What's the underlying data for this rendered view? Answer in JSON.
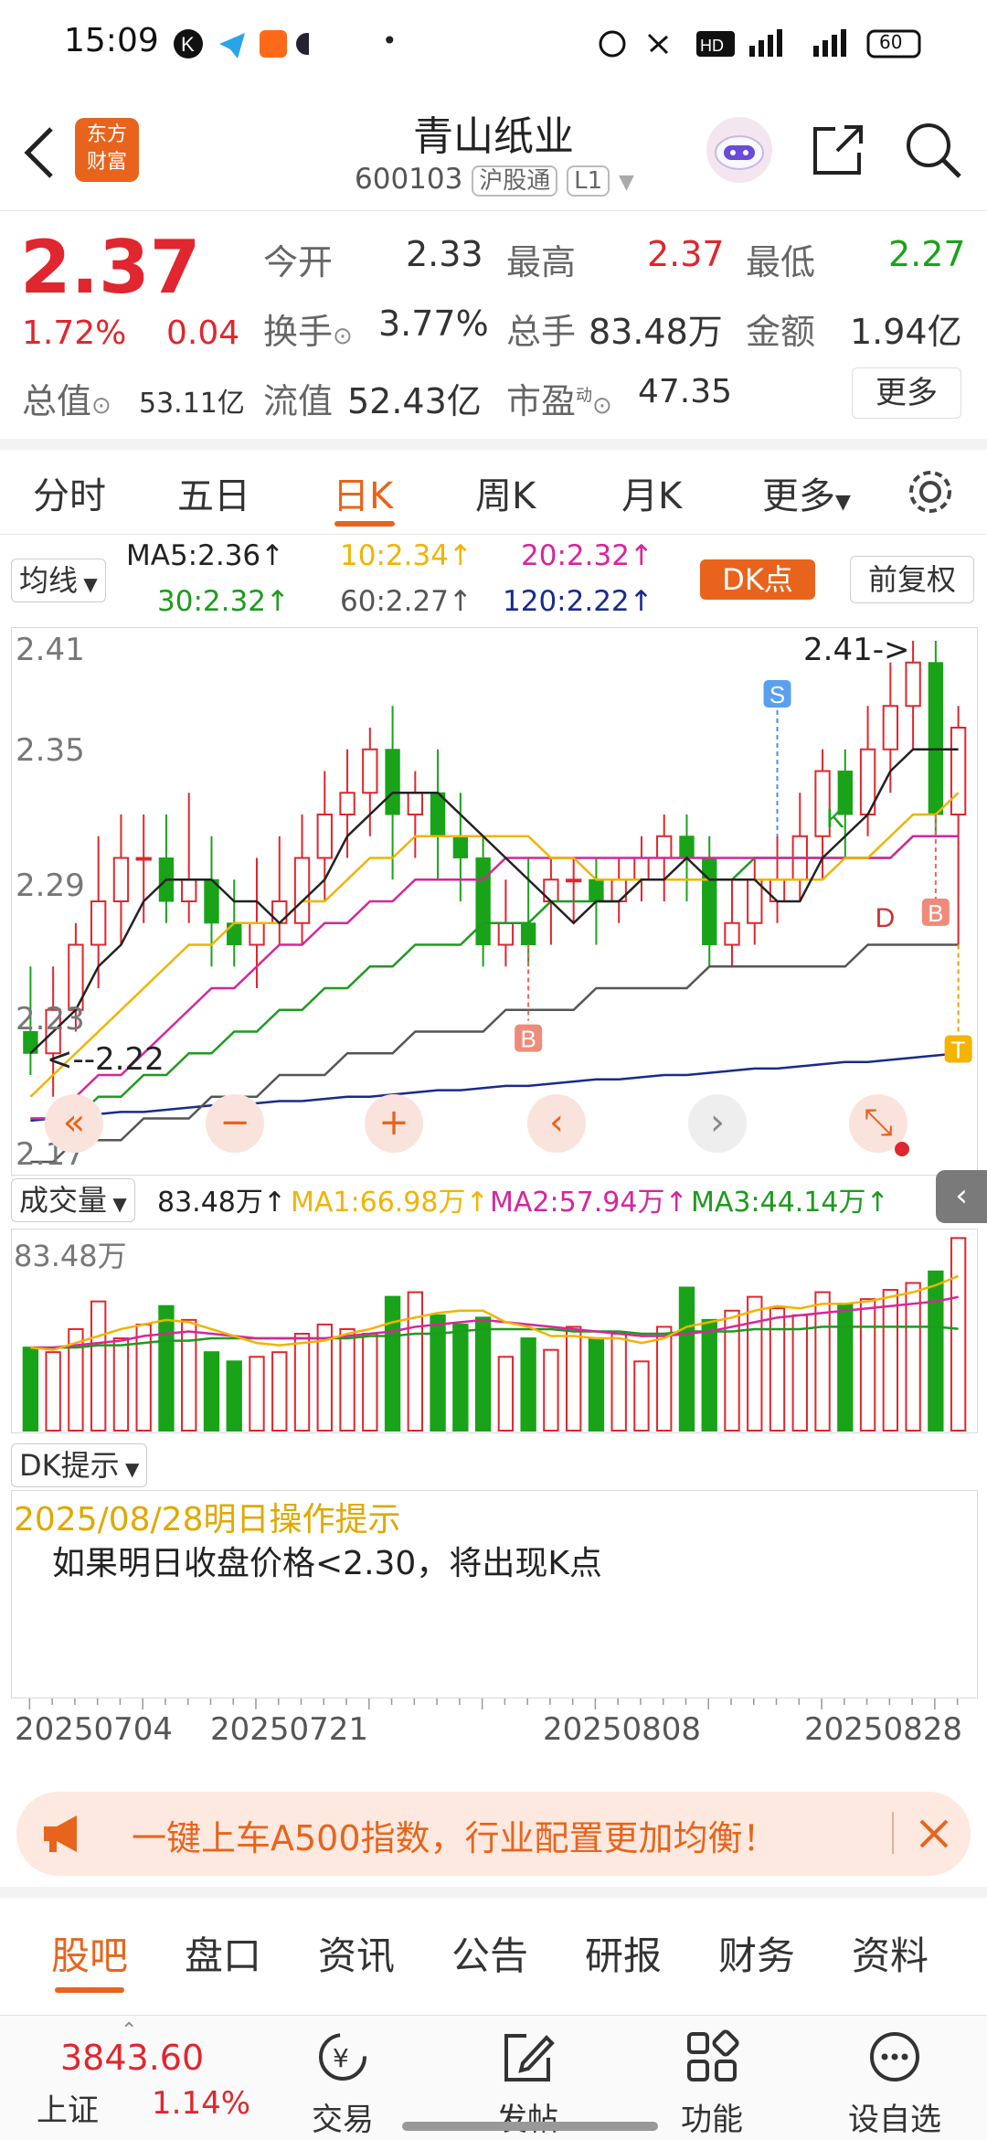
{
  "status_bar": {
    "time": "15:09",
    "battery": "60",
    "signal_a": "4G",
    "signal_b": "4G",
    "hd": "HD"
  },
  "header": {
    "title": "青山纸业",
    "code": "600103",
    "exchange_tag": "沪股通",
    "level_tag": "L1",
    "logo_line1": "东方",
    "logo_line2": "财富"
  },
  "quote": {
    "price": "2.37",
    "change_pct": "1.72%",
    "change": "0.04",
    "open_label": "今开",
    "open": "2.33",
    "high_label": "最高",
    "high": "2.37",
    "low_label": "最低",
    "low": "2.27",
    "turnover_label": "换手",
    "turnover": "3.77%",
    "volume_label": "总手",
    "volume": "83.48万",
    "amount_label": "金额",
    "amount": "1.94亿",
    "mktcap_label": "总值",
    "mktcap": "53.11亿",
    "float_label": "流值",
    "float": "52.43亿",
    "pe_label": "市盈",
    "pe_sup": "动",
    "pe": "47.35",
    "more_button": "更多"
  },
  "period_tabs": [
    "分时",
    "五日",
    "日K",
    "周K",
    "月K",
    "更多"
  ],
  "active_tab": "日K",
  "ma": {
    "selector": "均线",
    "ma5": "MA5:2.36",
    "ma10": "10:2.34",
    "ma20": "20:2.32",
    "ma30": "30:2.32",
    "ma60": "60:2.27",
    "ma120": "120:2.22",
    "dk_button": "DK点",
    "adjust_button": "前复权"
  },
  "colors": {
    "up": "#e0262e",
    "down": "#19a319",
    "ma5": "#222222",
    "ma10": "#f0b400",
    "ma20": "#d6269c",
    "ma30": "#1e9a1e",
    "ma60": "#555555",
    "ma120": "#1a2a8c",
    "accent": "#e8641c"
  },
  "chart": {
    "y_ticks": [
      "2.41",
      "2.35",
      "2.29",
      "2.23",
      "2.17"
    ],
    "max_note": "2.41->",
    "min_note": "<--2.22",
    "markers": {
      "s": "S",
      "k": "K",
      "d": "D",
      "b1": "B",
      "b2": "B",
      "t": "T"
    }
  },
  "chart_data": {
    "type": "candlestick",
    "ylim": [
      2.17,
      2.41
    ],
    "candles": [
      [
        2.23,
        2.22,
        2.26,
        2.21
      ],
      [
        2.22,
        2.24,
        2.26,
        2.2
      ],
      [
        2.24,
        2.27,
        2.28,
        2.23
      ],
      [
        2.27,
        2.29,
        2.32,
        2.25
      ],
      [
        2.29,
        2.31,
        2.33,
        2.27
      ],
      [
        2.31,
        2.31,
        2.33,
        2.28
      ],
      [
        2.31,
        2.29,
        2.33,
        2.28
      ],
      [
        2.29,
        2.3,
        2.34,
        2.28
      ],
      [
        2.3,
        2.28,
        2.32,
        2.26
      ],
      [
        2.28,
        2.27,
        2.3,
        2.26
      ],
      [
        2.27,
        2.28,
        2.31,
        2.25
      ],
      [
        2.28,
        2.29,
        2.32,
        2.27
      ],
      [
        2.28,
        2.31,
        2.33,
        2.27
      ],
      [
        2.31,
        2.33,
        2.35,
        2.29
      ],
      [
        2.33,
        2.34,
        2.36,
        2.31
      ],
      [
        2.34,
        2.36,
        2.37,
        2.32
      ],
      [
        2.36,
        2.33,
        2.38,
        2.3
      ],
      [
        2.33,
        2.34,
        2.35,
        2.31
      ],
      [
        2.34,
        2.32,
        2.36,
        2.3
      ],
      [
        2.32,
        2.31,
        2.34,
        2.29
      ],
      [
        2.31,
        2.27,
        2.32,
        2.26
      ],
      [
        2.27,
        2.28,
        2.3,
        2.26
      ],
      [
        2.28,
        2.27,
        2.31,
        2.26
      ],
      [
        2.29,
        2.3,
        2.31,
        2.27
      ],
      [
        2.3,
        2.3,
        2.31,
        2.28
      ],
      [
        2.3,
        2.29,
        2.31,
        2.27
      ],
      [
        2.29,
        2.3,
        2.31,
        2.28
      ],
      [
        2.3,
        2.31,
        2.32,
        2.29
      ],
      [
        2.31,
        2.32,
        2.33,
        2.29
      ],
      [
        2.32,
        2.31,
        2.33,
        2.29
      ],
      [
        2.31,
        2.27,
        2.32,
        2.26
      ],
      [
        2.27,
        2.28,
        2.3,
        2.26
      ],
      [
        2.28,
        2.3,
        2.31,
        2.27
      ],
      [
        2.29,
        2.3,
        2.32,
        2.28
      ],
      [
        2.3,
        2.32,
        2.34,
        2.29
      ],
      [
        2.32,
        2.35,
        2.36,
        2.3
      ],
      [
        2.35,
        2.33,
        2.36,
        2.31
      ],
      [
        2.33,
        2.36,
        2.38,
        2.32
      ],
      [
        2.36,
        2.38,
        2.4,
        2.34
      ],
      [
        2.38,
        2.4,
        2.41,
        2.36
      ],
      [
        2.4,
        2.33,
        2.41,
        2.32
      ],
      [
        2.33,
        2.37,
        2.38,
        2.27
      ]
    ],
    "ma5": [
      2.22,
      2.23,
      2.24,
      2.26,
      2.27,
      2.29,
      2.3,
      2.3,
      2.3,
      2.29,
      2.29,
      2.28,
      2.29,
      2.3,
      2.32,
      2.33,
      2.34,
      2.34,
      2.34,
      2.33,
      2.32,
      2.31,
      2.3,
      2.29,
      2.28,
      2.29,
      2.29,
      2.3,
      2.3,
      2.31,
      2.3,
      2.3,
      2.3,
      2.29,
      2.29,
      2.31,
      2.32,
      2.33,
      2.35,
      2.36,
      2.36,
      2.36
    ],
    "ma10": [
      2.2,
      2.21,
      2.22,
      2.23,
      2.24,
      2.25,
      2.26,
      2.27,
      2.27,
      2.28,
      2.28,
      2.28,
      2.29,
      2.29,
      2.3,
      2.31,
      2.31,
      2.32,
      2.32,
      2.32,
      2.32,
      2.32,
      2.32,
      2.31,
      2.31,
      2.3,
      2.3,
      2.3,
      2.3,
      2.3,
      2.3,
      2.3,
      2.3,
      2.3,
      2.3,
      2.3,
      2.31,
      2.31,
      2.32,
      2.33,
      2.33,
      2.34
    ],
    "ma20": [
      2.19,
      2.19,
      2.2,
      2.21,
      2.21,
      2.22,
      2.23,
      2.24,
      2.25,
      2.25,
      2.26,
      2.27,
      2.27,
      2.28,
      2.28,
      2.29,
      2.29,
      2.3,
      2.3,
      2.3,
      2.3,
      2.31,
      2.31,
      2.31,
      2.31,
      2.31,
      2.31,
      2.31,
      2.31,
      2.31,
      2.31,
      2.31,
      2.31,
      2.31,
      2.31,
      2.31,
      2.31,
      2.31,
      2.31,
      2.32,
      2.32,
      2.32
    ],
    "ma30": [
      2.19,
      2.19,
      2.19,
      2.2,
      2.2,
      2.21,
      2.21,
      2.22,
      2.22,
      2.23,
      2.23,
      2.24,
      2.24,
      2.25,
      2.25,
      2.26,
      2.26,
      2.27,
      2.27,
      2.27,
      2.28,
      2.28,
      2.28,
      2.29,
      2.29,
      2.29,
      2.29,
      2.3,
      2.3,
      2.3,
      2.3,
      2.3,
      2.31,
      2.31,
      2.31,
      2.31,
      2.31,
      2.31,
      2.31,
      2.32,
      2.32,
      2.32
    ],
    "ma60": [
      2.17,
      2.17,
      2.18,
      2.18,
      2.18,
      2.19,
      2.19,
      2.19,
      2.2,
      2.2,
      2.2,
      2.21,
      2.21,
      2.21,
      2.22,
      2.22,
      2.22,
      2.23,
      2.23,
      2.23,
      2.23,
      2.24,
      2.24,
      2.24,
      2.24,
      2.25,
      2.25,
      2.25,
      2.25,
      2.25,
      2.26,
      2.26,
      2.26,
      2.26,
      2.26,
      2.26,
      2.26,
      2.27,
      2.27,
      2.27,
      2.27,
      2.27
    ],
    "ma120": [
      2.189,
      2.19,
      2.191,
      2.192,
      2.193,
      2.193,
      2.194,
      2.195,
      2.196,
      2.196,
      2.197,
      2.198,
      2.198,
      2.199,
      2.2,
      2.2,
      2.201,
      2.202,
      2.203,
      2.203,
      2.204,
      2.205,
      2.205,
      2.206,
      2.207,
      2.208,
      2.208,
      2.209,
      2.21,
      2.21,
      2.211,
      2.212,
      2.213,
      2.213,
      2.214,
      2.215,
      2.216,
      2.216,
      2.217,
      2.218,
      2.219,
      2.22
    ],
    "volume": {
      "max_label": "83.48万",
      "values": [
        36,
        34,
        44,
        56,
        40,
        46,
        54,
        48,
        34,
        30,
        32,
        34,
        42,
        46,
        44,
        42,
        58,
        60,
        50,
        46,
        49,
        32,
        40,
        35,
        45,
        40,
        42,
        30,
        45,
        62,
        48,
        52,
        58,
        53,
        50,
        60,
        55,
        57,
        61,
        64,
        69,
        83.48
      ],
      "ma1": [
        36,
        35,
        38,
        41,
        44,
        46,
        48,
        47,
        44,
        41,
        38,
        37,
        38,
        39,
        42,
        44,
        47,
        49,
        51,
        52,
        52,
        47,
        45,
        41,
        41,
        40,
        40,
        38,
        40,
        45,
        47,
        49,
        52,
        54,
        53,
        55,
        55,
        56,
        58,
        60,
        63,
        66.98
      ],
      "ma2": [
        36,
        36,
        37,
        38,
        39,
        41,
        42,
        43,
        42,
        41,
        40,
        40,
        40,
        40,
        41,
        42,
        43,
        45,
        46,
        47,
        48,
        47,
        46,
        45,
        44,
        43,
        42,
        41,
        41,
        42,
        43,
        45,
        47,
        49,
        50,
        51,
        52,
        53,
        54,
        55,
        56,
        57.94
      ],
      "ma3": [
        36,
        36,
        36,
        37,
        37,
        38,
        39,
        39,
        40,
        40,
        40,
        40,
        40,
        40,
        40,
        41,
        41,
        42,
        42,
        43,
        44,
        44,
        44,
        44,
        43,
        43,
        43,
        42,
        42,
        43,
        43,
        43,
        44,
        44,
        44,
        45,
        45,
        45,
        45,
        45,
        45,
        44.14
      ]
    },
    "x_dates": [
      "20250704",
      "20250721",
      "20250808",
      "20250828"
    ]
  },
  "volume_header": {
    "selector": "成交量",
    "value": "83.48万",
    "ma1": "MA1:66.98万",
    "ma2": "MA2:57.94万",
    "ma3": "MA3:44.14万"
  },
  "dk_tip": {
    "selector": "DK提示",
    "date_title": "2025/08/28明日操作提示",
    "message": "如果明日收盘价格<2.30，将出现K点"
  },
  "banner": {
    "text": "一键上车A500指数，行业配置更加均衡！"
  },
  "bottom_tabs": [
    "股吧",
    "盘口",
    "资讯",
    "公告",
    "研报",
    "财务",
    "资料"
  ],
  "nav": {
    "index_value": "3843.60",
    "index_name": "上证",
    "index_change": "1.14%",
    "trade": "交易",
    "post": "发帖",
    "function": "功能",
    "watchlist": "设自选"
  }
}
